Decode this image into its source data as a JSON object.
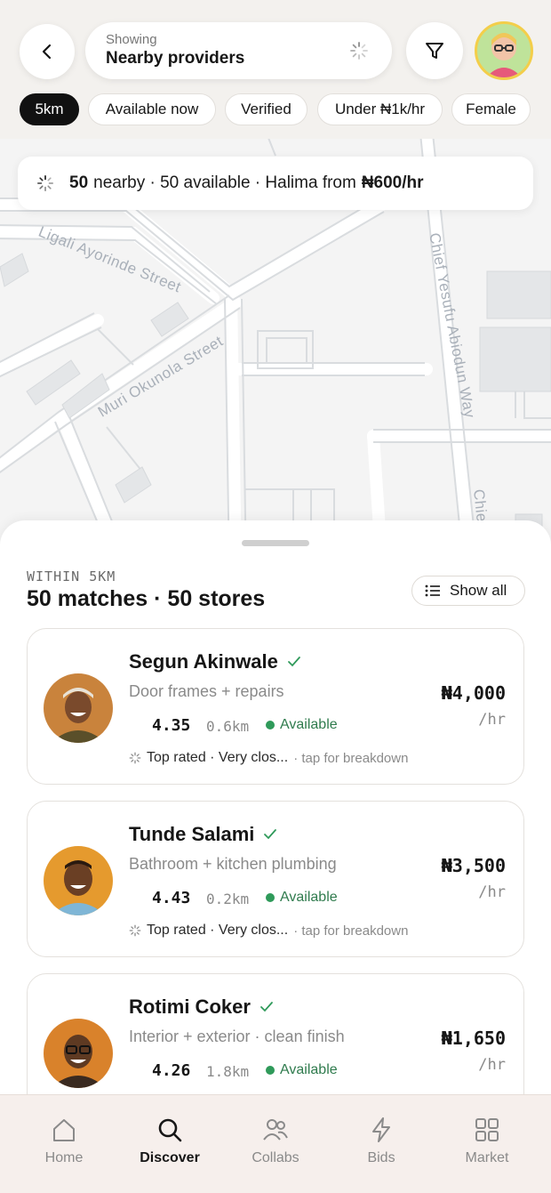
{
  "header": {
    "search_small": "Showing",
    "search_main": "Nearby providers"
  },
  "chips": [
    {
      "label": "5km",
      "active": true
    },
    {
      "label": "Available now",
      "active": false
    },
    {
      "label": "Verified",
      "active": false
    },
    {
      "label": "Under ₦1k/hr",
      "active": false
    },
    {
      "label": "Female",
      "active": false
    }
  ],
  "summary": {
    "count": "50",
    "nearby_text": "nearby · 50 available · Halima from",
    "price": "₦600/hr"
  },
  "map": {
    "streets": [
      "Ligali Ayorinde Street",
      "Muri Okunola Street",
      "Chief Yesufu Abiodun Way",
      "Chie"
    ]
  },
  "sheet": {
    "within": "WITHIN 5KM",
    "matches": "50 matches · 50 stores",
    "show_all": "Show all"
  },
  "providers": [
    {
      "name": "Segun Akinwale",
      "desc": "Door frames + repairs",
      "rating": "4.35",
      "distance": "0.6km",
      "status": "Available",
      "tags": "Top rated · Very clos...",
      "hint": "· tap for breakdown",
      "price": "₦4,000",
      "per": "/hr",
      "photo_color": "#c9833c"
    },
    {
      "name": "Tunde Salami",
      "desc": "Bathroom + kitchen plumbing",
      "rating": "4.43",
      "distance": "0.2km",
      "status": "Available",
      "tags": "Top rated · Very clos...",
      "hint": "· tap for breakdown",
      "price": "₦3,500",
      "per": "/hr",
      "photo_color": "#e59a2e"
    },
    {
      "name": "Rotimi Coker",
      "desc": "Interior + exterior · clean finish",
      "rating": "4.26",
      "distance": "1.8km",
      "status": "Available",
      "tags": "",
      "hint": "",
      "price": "₦1,650",
      "per": "/hr",
      "photo_color": "#d9822b"
    }
  ],
  "nav": [
    {
      "label": "Home",
      "icon": "home-icon",
      "active": false
    },
    {
      "label": "Discover",
      "icon": "search-icon",
      "active": true
    },
    {
      "label": "Collabs",
      "icon": "people-icon",
      "active": false
    },
    {
      "label": "Bids",
      "icon": "bolt-icon",
      "active": false
    },
    {
      "label": "Market",
      "icon": "grid-icon",
      "active": false
    }
  ],
  "colors": {
    "available_green": "#2f7b4d",
    "active_chip": "#111111",
    "nav_bg": "#f6efec"
  }
}
